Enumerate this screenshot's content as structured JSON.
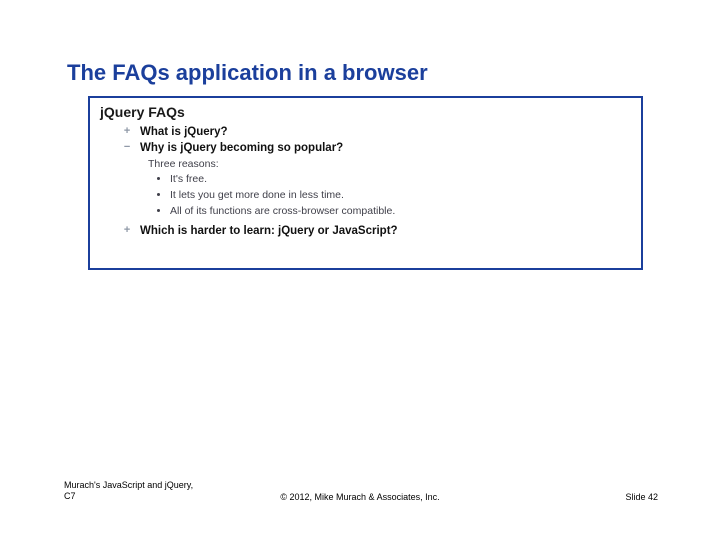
{
  "slide": {
    "title": "The FAQs application in a browser"
  },
  "app": {
    "heading": "jQuery FAQs"
  },
  "faqs": [
    {
      "icon": "plus-icon",
      "icon_glyph": "+",
      "expanded": false,
      "question": "What is jQuery?"
    },
    {
      "icon": "minus-icon",
      "icon_glyph": "−",
      "expanded": true,
      "question": "Why is jQuery becoming so popular?",
      "answer_lead": "Three reasons:",
      "answer_items": [
        "It's free.",
        "It lets you get more done in less time.",
        "All of its functions are cross-browser compatible."
      ]
    },
    {
      "icon": "plus-icon",
      "icon_glyph": "+",
      "expanded": false,
      "question": "Which is harder to learn: jQuery or JavaScript?"
    }
  ],
  "footer": {
    "left_line1": "Murach's JavaScript and jQuery,",
    "left_line2": "C7",
    "center": "© 2012, Mike Murach & Associates, Inc.",
    "right": "Slide 42"
  }
}
